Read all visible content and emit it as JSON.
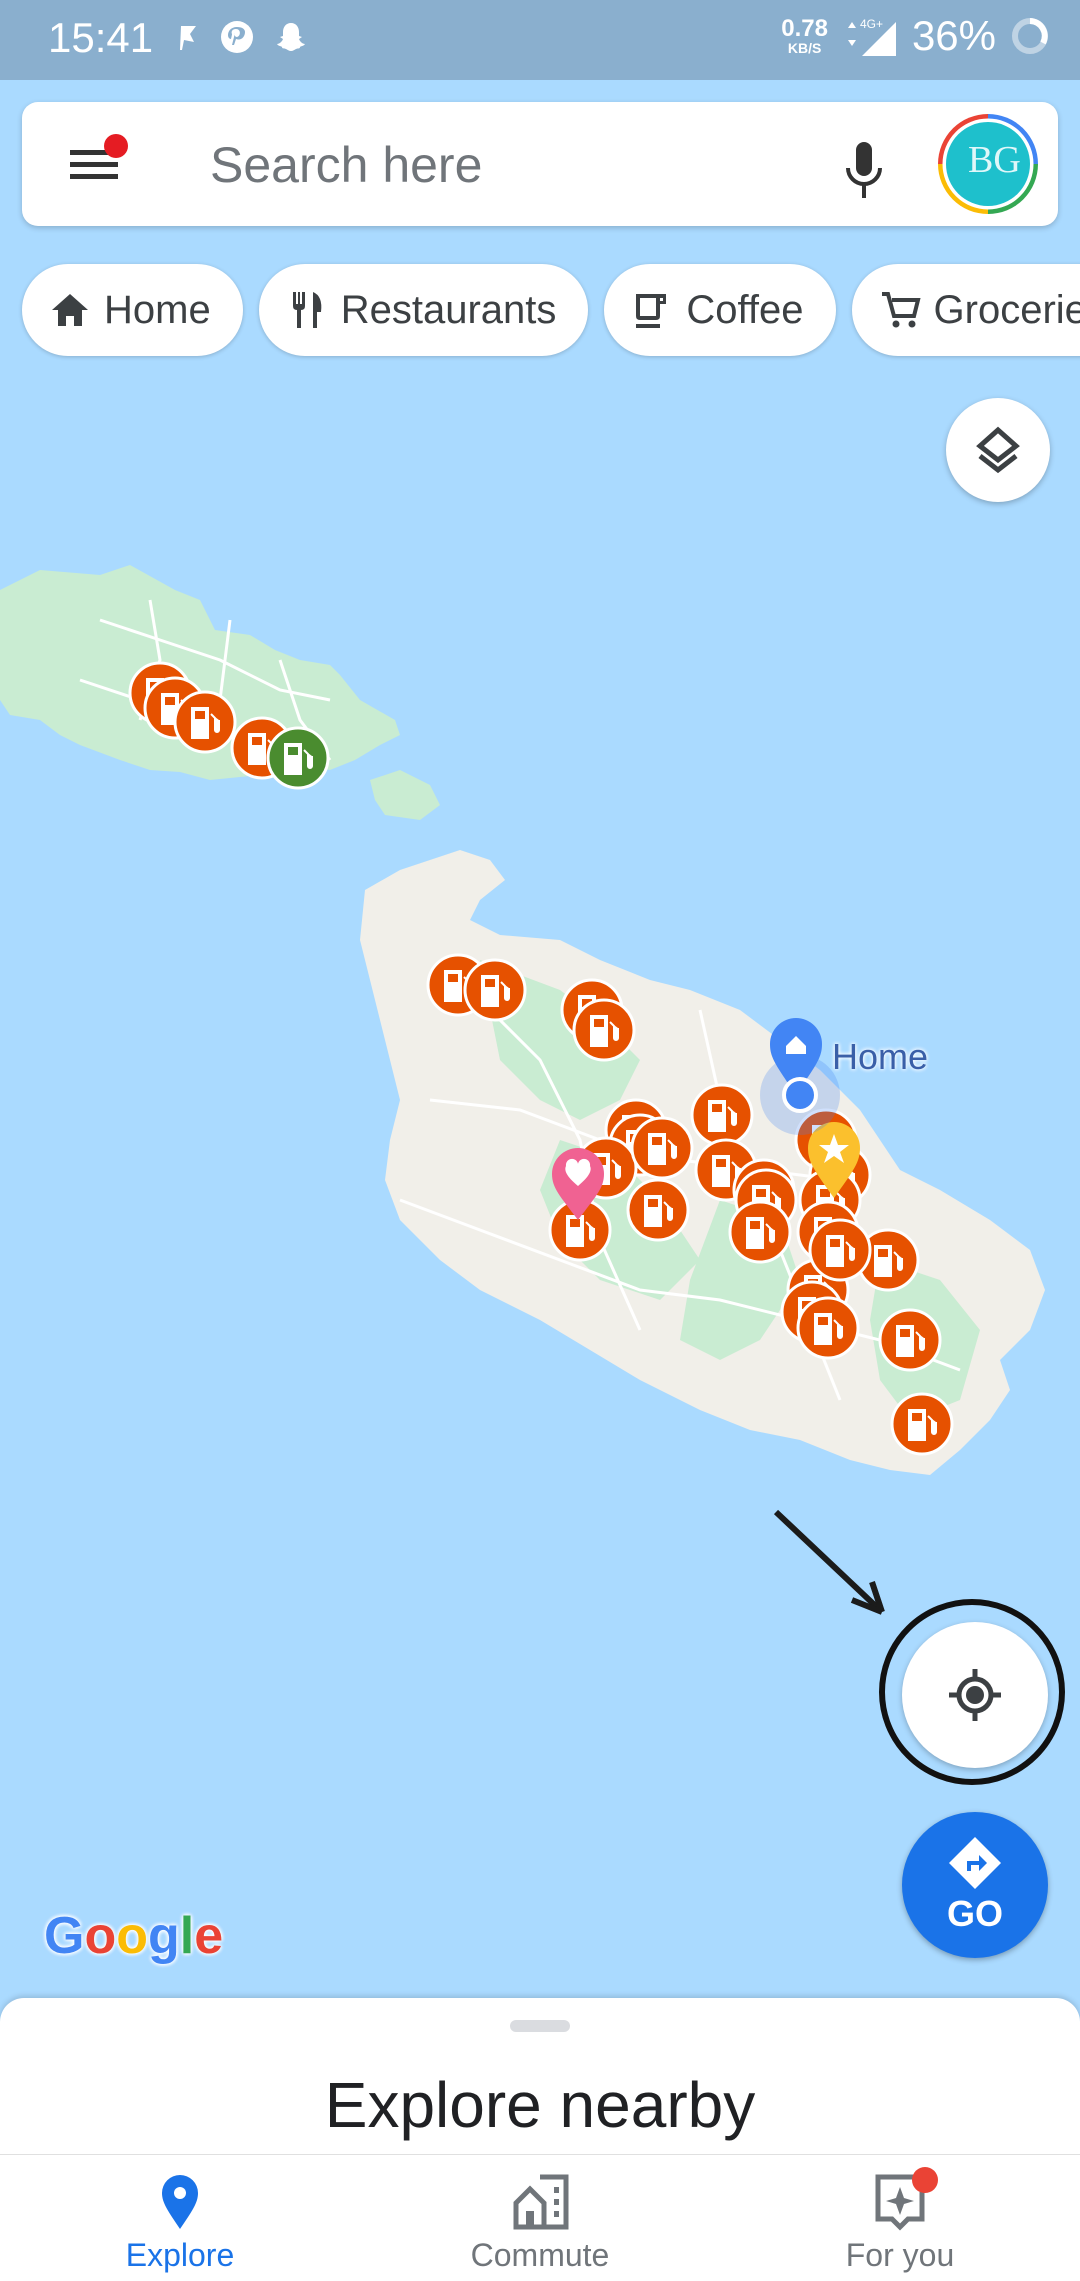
{
  "status_bar": {
    "time": "15:41",
    "left_icons": [
      "navigation-flag-icon",
      "pinterest-icon",
      "snapchat-icon"
    ],
    "net_speed_value": "0.78",
    "net_speed_unit": "KB/S",
    "network": "4G+",
    "battery": "36%"
  },
  "search": {
    "placeholder": "Search here",
    "menu_has_notification": true,
    "avatar_initials": "BG"
  },
  "chips": [
    {
      "label": "Home",
      "icon": "home-icon"
    },
    {
      "label": "Restaurants",
      "icon": "restaurant-icon"
    },
    {
      "label": "Coffee",
      "icon": "coffee-icon"
    },
    {
      "label": "Groceries",
      "icon": "cart-icon"
    }
  ],
  "map": {
    "home_label": "Home",
    "markers": {
      "gas_station_orange_count": 30,
      "gas_station_green_count": 1,
      "saved_heart_pin": 1,
      "starred_pin": 1
    },
    "colors": {
      "water": "#aadaff",
      "land": "#f1efe9",
      "park": "#c9ecd2",
      "gas_marker": "#e65100",
      "gas_marker_alt": "#4a8c2f",
      "home_pin": "#4285f4",
      "heart_pin": "#f06292",
      "star_pin": "#fbc02d"
    },
    "logo": "Google",
    "go_label": "GO"
  },
  "sheet": {
    "title": "Explore nearby"
  },
  "bottom_nav": [
    {
      "label": "Explore",
      "active": true,
      "icon": "explore-pin-icon"
    },
    {
      "label": "Commute",
      "active": false,
      "icon": "commute-icon"
    },
    {
      "label": "For you",
      "active": false,
      "icon": "for-you-icon",
      "badge": true
    }
  ],
  "accent_color": "#1a73e8"
}
